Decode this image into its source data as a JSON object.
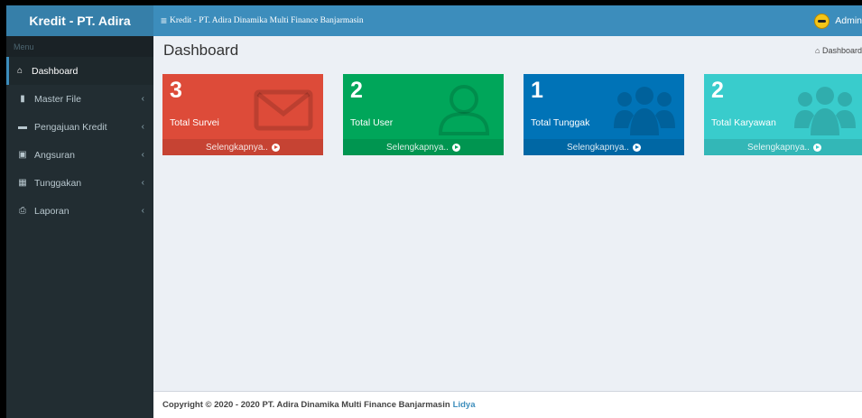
{
  "header": {
    "brand": "Kredit - PT. Adira",
    "toggle_icon": "≡",
    "breadcrumb_title": "Kredit - PT. Adira Dinamika Multi Finance Banjarmasin",
    "user_name": "Admin"
  },
  "sidebar": {
    "header": "Menu",
    "items": [
      {
        "label": "Dashboard",
        "icon": "home-icon",
        "glyph": "⌂",
        "chevron": ""
      },
      {
        "label": "Master File",
        "icon": "file-icon",
        "glyph": "▮",
        "chevron": "‹"
      },
      {
        "label": "Pengajuan Kredit",
        "icon": "credit-card-icon",
        "glyph": "▬",
        "chevron": "‹"
      },
      {
        "label": "Angsuran",
        "icon": "money-icon",
        "glyph": "▣",
        "chevron": "‹"
      },
      {
        "label": "Tunggakan",
        "icon": "calendar-icon",
        "glyph": "▦",
        "chevron": "‹"
      },
      {
        "label": "Laporan",
        "icon": "print-icon",
        "glyph": "⎙",
        "chevron": "‹"
      }
    ]
  },
  "content": {
    "title": "Dashboard",
    "breadcrumb": "Dashboard",
    "breadcrumb_icon": "⌂"
  },
  "boxes": [
    {
      "value": "3",
      "label": "Total Survei",
      "more": "Selengkapnya..",
      "color": "#dd4b39",
      "icon": "envelope-icon"
    },
    {
      "value": "2",
      "label": "Total User",
      "more": "Selengkapnya..",
      "color": "#00a65a",
      "icon": "user-icon"
    },
    {
      "value": "1",
      "label": "Total Tunggak",
      "more": "Selengkapnya..",
      "color": "#0073b7",
      "icon": "users-icon"
    },
    {
      "value": "2",
      "label": "Total Karyawan",
      "more": "Selengkapnya..",
      "color": "#39cccc",
      "icon": "users-icon"
    }
  ],
  "footer": {
    "copyright": "Copyright © 2020 - 2020 PT. Adira Dinamika Multi Finance Banjarmasin",
    "author": "Lidya"
  },
  "colors": {
    "brand": "#367fa9",
    "navbar": "#3c8dbc",
    "sidebar": "#222d32"
  }
}
